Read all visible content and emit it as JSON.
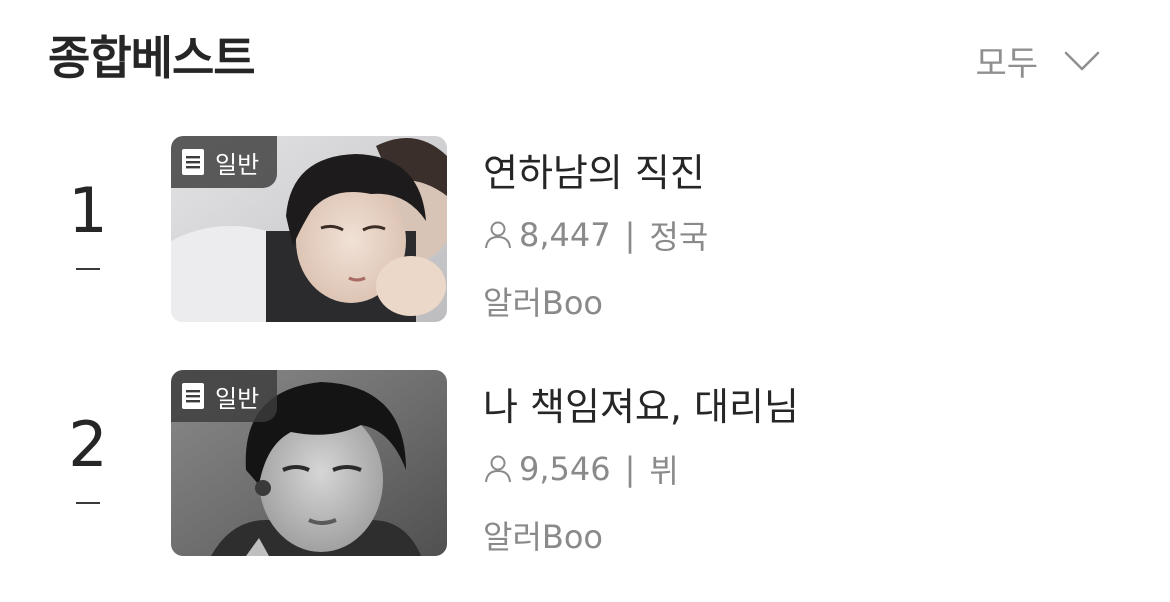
{
  "header": {
    "title": "종합베스트",
    "filter_label": "모두",
    "filter_icon": "chevron-down-icon"
  },
  "items": [
    {
      "rank": "1",
      "rank_change_icon": "no-change-dash",
      "badge": "일반",
      "badge_icon": "document-icon",
      "title": "연하남의 직진",
      "views_icon": "person-icon",
      "views": "8,447",
      "separator": "|",
      "character": "정국",
      "author": "알러Boo"
    },
    {
      "rank": "2",
      "rank_change_icon": "no-change-dash",
      "badge": "일반",
      "badge_icon": "document-icon",
      "title": "나 책임져요, 대리님",
      "views_icon": "person-icon",
      "views": "9,546",
      "separator": "|",
      "character": "뷔",
      "author": "알러Boo"
    }
  ],
  "colors": {
    "title_text": "#262626",
    "secondary_text": "#8a8a8a",
    "badge_bg": "#3c3c3c"
  }
}
